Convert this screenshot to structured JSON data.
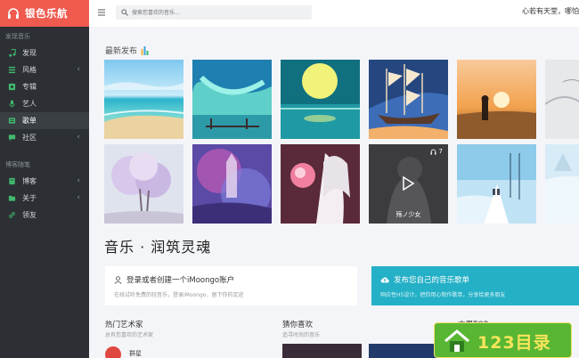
{
  "brand": {
    "title": "银色乐航",
    "icon": "headphones-icon",
    "color": "#f05b4f"
  },
  "sidebar": {
    "section1": "发现音乐",
    "items1": [
      {
        "label": "发现",
        "icon": "music-note-icon",
        "has_chevron": false
      },
      {
        "label": "风格",
        "icon": "list-icon",
        "has_chevron": true
      },
      {
        "label": "专辑",
        "icon": "album-icon",
        "has_chevron": false
      },
      {
        "label": "艺人",
        "icon": "microphone-icon",
        "has_chevron": false
      },
      {
        "label": "歌单",
        "icon": "playlist-icon",
        "has_chevron": false,
        "active": true
      },
      {
        "label": "社区",
        "icon": "chat-icon",
        "has_chevron": true
      }
    ],
    "section2": "博客随笔",
    "items2": [
      {
        "label": "博客",
        "icon": "book-icon",
        "has_chevron": true
      },
      {
        "label": "关于",
        "icon": "folder-icon",
        "has_chevron": true
      },
      {
        "label": "领友",
        "icon": "link-icon",
        "has_chevron": false
      }
    ],
    "chevron": "‹"
  },
  "topbar": {
    "menu_icon": "hamburger-icon",
    "search_placeholder": "搜索您喜欢的音乐...",
    "user_text": "心若有天堂，哪怕"
  },
  "main": {
    "latest_title": "最新发布",
    "cards_row2": {
      "video_badge": "7",
      "video_caption": "殇ノ少女"
    },
    "hero_title": "音乐 · 润筑灵魂",
    "login_panel": {
      "title": "登录或者创建一个iMoongo账户",
      "subtitle": "在线试听免费的轻音乐，登录iMoongo，留下你的足迹"
    },
    "publish_panel": {
      "title": "发布您自己的音乐歌单",
      "subtitle": "响应性H5设计，把你用心制作歌单，分享给更多朋友"
    },
    "hot_artists": {
      "title": "热门艺术家",
      "subtitle": "总有您喜欢的艺术家"
    },
    "guess": {
      "title": "猜你喜欢",
      "subtitle": "追寻时尚的音乐"
    },
    "top": {
      "title": "本周TOP"
    },
    "artist_name": "群星"
  },
  "watermark": {
    "text": "123目录"
  },
  "colors": {
    "sidebar_bg": "#2c3034",
    "accent_red": "#f05b4f",
    "teal": "#24b0c6"
  }
}
